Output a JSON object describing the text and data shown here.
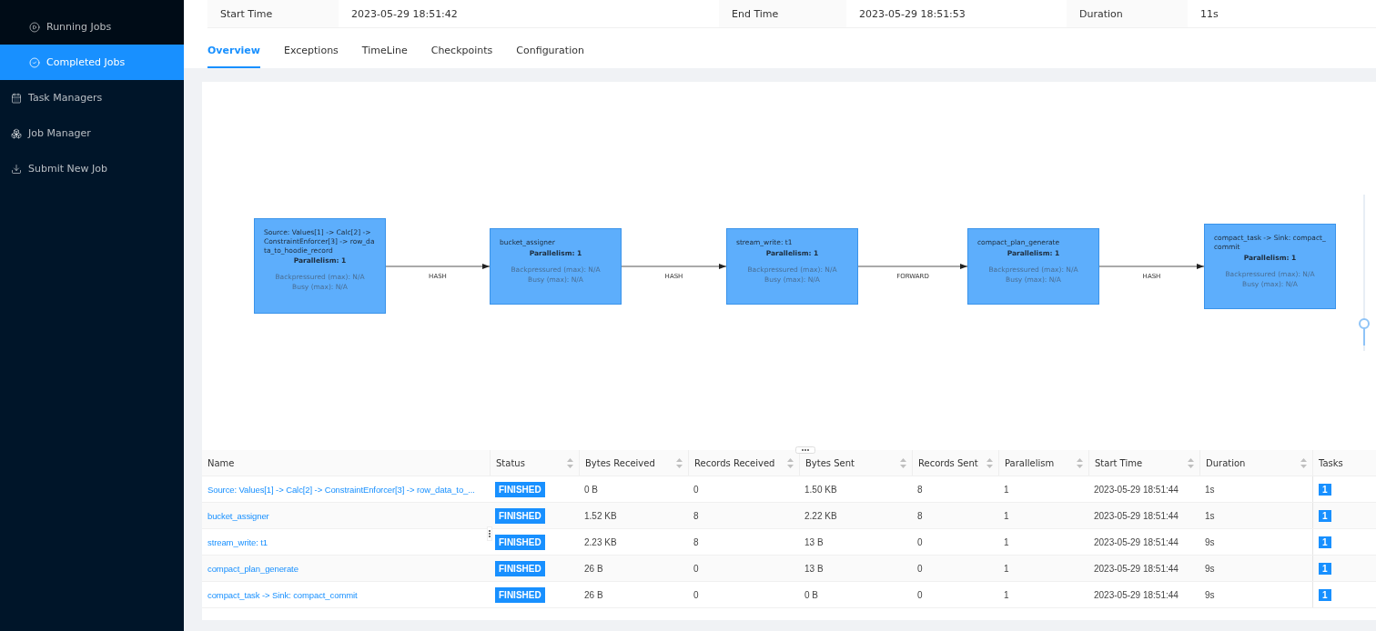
{
  "sidebar": {
    "items": [
      {
        "label": "Running Jobs",
        "kind": "sub",
        "selected": false
      },
      {
        "label": "Completed Jobs",
        "kind": "sub",
        "selected": true
      },
      {
        "label": "Task Managers",
        "kind": "top",
        "selected": false
      },
      {
        "label": "Job Manager",
        "kind": "top",
        "selected": false
      },
      {
        "label": "Submit New Job",
        "kind": "top",
        "selected": false
      }
    ]
  },
  "job_info": [
    {
      "label": "Start Time",
      "value": "2023-05-29 18:51:42"
    },
    {
      "label": "End Time",
      "value": "2023-05-29 18:51:53"
    },
    {
      "label": "Duration",
      "value": "11s"
    }
  ],
  "tabs": [
    {
      "label": "Overview",
      "selected": true
    },
    {
      "label": "Exceptions",
      "selected": false
    },
    {
      "label": "TimeLine",
      "selected": false
    },
    {
      "label": "Checkpoints",
      "selected": false
    },
    {
      "label": "Configuration",
      "selected": false
    }
  ],
  "graph": {
    "zoom": {
      "level": 0.15
    },
    "nodes": [
      {
        "title": "Source: Values[1] -> Calc[2] -> ConstraintEnforcer[3] -> row_data_to_hoodie_record",
        "parallelism": "Parallelism: 1",
        "backpressured": "Backpressured (max): N/A",
        "busy": "Busy (max): N/A"
      },
      {
        "title": "bucket_assigner",
        "parallelism": "Parallelism: 1",
        "backpressured": "Backpressured (max): N/A",
        "busy": "Busy (max): N/A"
      },
      {
        "title": "stream_write: t1",
        "parallelism": "Parallelism: 1",
        "backpressured": "Backpressured (max): N/A",
        "busy": "Busy (max): N/A"
      },
      {
        "title": "compact_plan_generate",
        "parallelism": "Parallelism: 1",
        "backpressured": "Backpressured (max): N/A",
        "busy": "Busy (max): N/A"
      },
      {
        "title": "compact_task -> Sink: compact_commit",
        "parallelism": "Parallelism: 1",
        "backpressured": "Backpressured (max): N/A",
        "busy": "Busy (max): N/A"
      }
    ],
    "edges": [
      "HASH",
      "HASH",
      "FORWARD",
      "HASH"
    ]
  },
  "table": {
    "columns": [
      {
        "label": "Name",
        "sortable": false
      },
      {
        "label": "Status",
        "sortable": true
      },
      {
        "label": "Bytes Received",
        "sortable": true
      },
      {
        "label": "Records Received",
        "sortable": true
      },
      {
        "label": "Bytes Sent",
        "sortable": true
      },
      {
        "label": "Records Sent",
        "sortable": true
      },
      {
        "label": "Parallelism",
        "sortable": true
      },
      {
        "label": "Start Time",
        "sortable": true
      },
      {
        "label": "Duration",
        "sortable": true
      },
      {
        "label": "Tasks",
        "sortable": false
      }
    ],
    "rows": [
      [
        "Source: Values[1] -> Calc[2] -> ConstraintEnforcer[3] -> row_data_to_...",
        "FINISHED",
        "0 B",
        "0",
        "1.50 KB",
        "8",
        "1",
        "2023-05-29 18:51:44",
        "1s",
        "1"
      ],
      [
        "bucket_assigner",
        "FINISHED",
        "1.52 KB",
        "8",
        "2.22 KB",
        "8",
        "1",
        "2023-05-29 18:51:44",
        "1s",
        "1"
      ],
      [
        "stream_write: t1",
        "FINISHED",
        "2.23 KB",
        "8",
        "13 B",
        "0",
        "1",
        "2023-05-29 18:51:44",
        "9s",
        "1"
      ],
      [
        "compact_plan_generate",
        "FINISHED",
        "26 B",
        "0",
        "13 B",
        "0",
        "1",
        "2023-05-29 18:51:44",
        "9s",
        "1"
      ],
      [
        "compact_task -> Sink: compact_commit",
        "FINISHED",
        "26 B",
        "0",
        "0 B",
        "0",
        "1",
        "2023-05-29 18:51:44",
        "9s",
        "1"
      ]
    ]
  }
}
